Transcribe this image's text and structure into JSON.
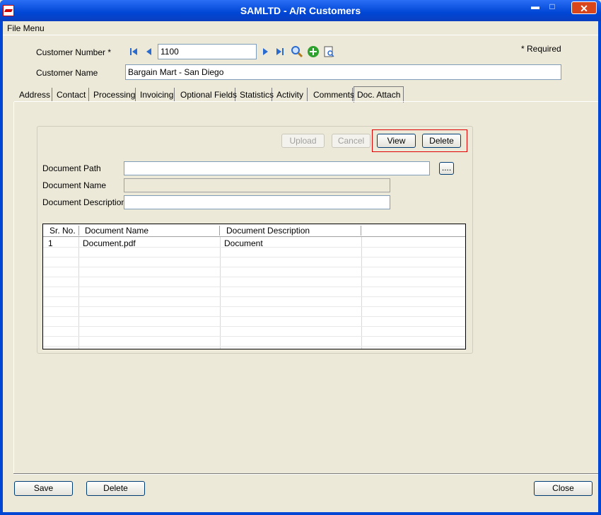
{
  "window": {
    "title": "SAMLTD - A/R Customers",
    "minimize": "▬",
    "maximize": "□",
    "close": "✕"
  },
  "menu": {
    "file_menu": "File Menu"
  },
  "header": {
    "customer_number_label": "Customer Number *",
    "customer_number_value": "1100",
    "required_note": "*  Required",
    "customer_name_label": "Customer Name",
    "customer_name_value": "Bargain Mart - San Diego"
  },
  "tabs": [
    {
      "label": "Address"
    },
    {
      "label": "Contact"
    },
    {
      "label": "Processing"
    },
    {
      "label": "Invoicing"
    },
    {
      "label": "Optional Fields"
    },
    {
      "label": "Statistics"
    },
    {
      "label": "Activity"
    },
    {
      "label": "Comments"
    },
    {
      "label": "Doc. Attach"
    }
  ],
  "doc_attach": {
    "upload_button": "Upload",
    "cancel_button": "Cancel",
    "view_button": "View",
    "delete_button": "Delete",
    "browse_button": "....",
    "document_path_label": "Document Path",
    "document_path_value": "",
    "document_name_label": "Document Name",
    "document_name_value": "",
    "document_description_label": "Document Description",
    "document_description_value": ""
  },
  "grid": {
    "columns": [
      "Sr. No.",
      "Document Name",
      "Document Description"
    ],
    "rows": [
      {
        "sr_no": "1",
        "document_name": "Document.pdf",
        "document_description": "Document"
      }
    ]
  },
  "footer": {
    "save_button": "Save",
    "delete_button": "Delete",
    "close_button": "Close"
  },
  "colors": {
    "title_bar": "#0046d5",
    "highlight_border": "#e00000",
    "window_bg": "#ece9d8"
  }
}
